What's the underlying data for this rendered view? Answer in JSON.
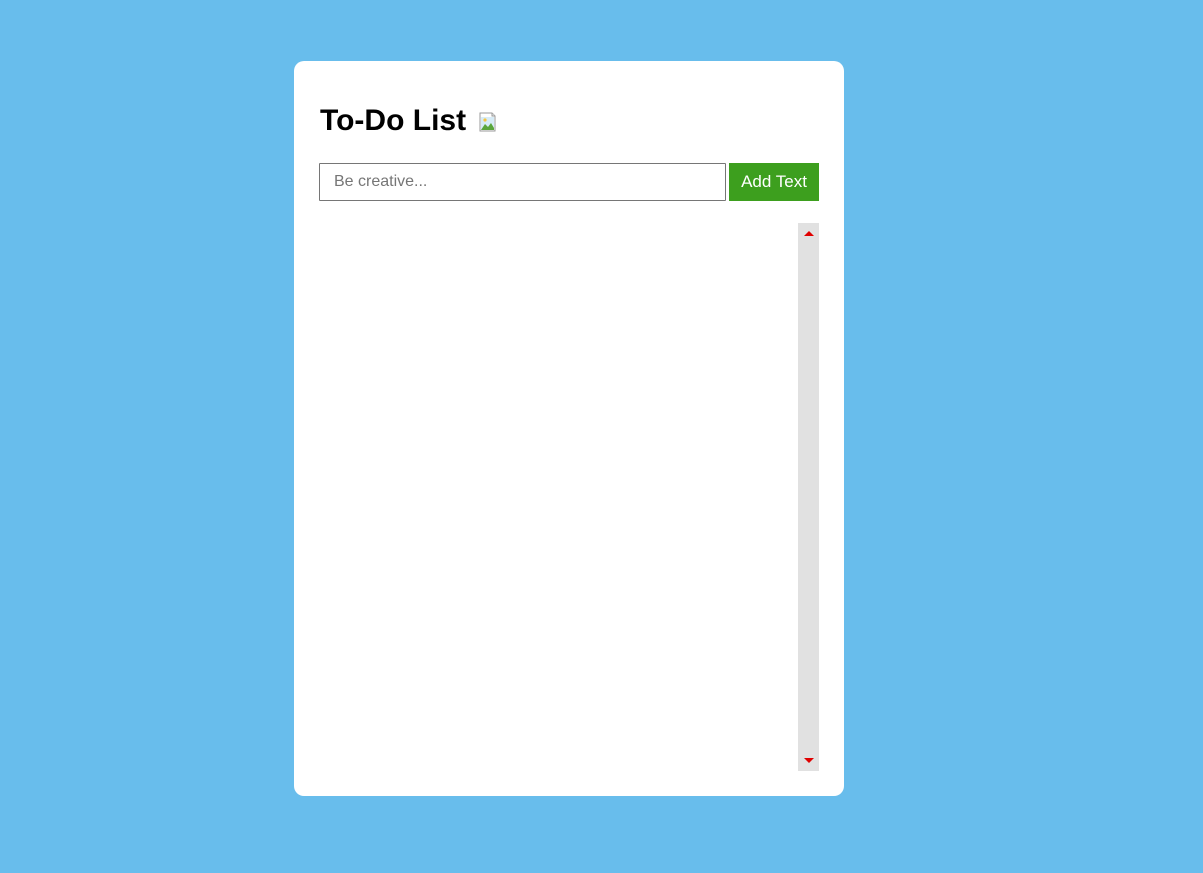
{
  "app": {
    "title": "To-Do List",
    "title_image_icon": "broken-image-icon"
  },
  "form": {
    "input_value": "",
    "input_placeholder": "Be creative...",
    "add_button_label": "Add Text"
  },
  "list": {
    "items": []
  },
  "colors": {
    "background": "#68bdec",
    "card": "#ffffff",
    "add_button": "#3d9f1e",
    "scrollbar_track": "#e1e1e1",
    "scroll_arrows": "#e00000"
  }
}
